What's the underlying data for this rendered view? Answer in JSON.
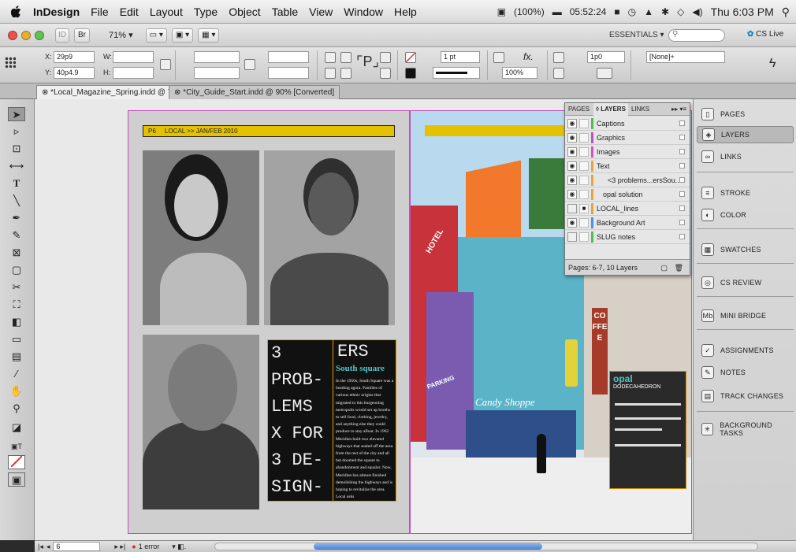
{
  "menubar": {
    "app": "InDesign",
    "items": [
      "File",
      "Edit",
      "Layout",
      "Type",
      "Object",
      "Table",
      "View",
      "Window",
      "Help"
    ],
    "battery": "(100%)",
    "timer": "05:52:24",
    "clock": "Thu 6:03 PM"
  },
  "appbar": {
    "br": "Br",
    "zoom": "71%",
    "workspace": "ESSENTIALS",
    "cslive": "CS Live"
  },
  "control": {
    "x_label": "X:",
    "x_value": "29p9",
    "y_label": "Y:",
    "y_value": "40p4.9",
    "w_label": "W:",
    "h_label": "H:",
    "stroke_weight": "1 pt",
    "opacity": "100%",
    "spacing": "1p0",
    "style": "[None]+"
  },
  "tabs": [
    {
      "label": "*Local_Magazine_Spring.indd @ 71%"
    },
    {
      "label": "*City_Guide_Start.indd @ 90% [Converted]"
    }
  ],
  "spread": {
    "folio": "P6",
    "header": "LOCAL >> JAN/FEB 2010",
    "big_title_left": [
      "3",
      "PROB-",
      "LEMS",
      "X FOR",
      "3 DE-",
      "SIGN-"
    ],
    "big_title_right": "ERS",
    "subhead": "South square",
    "body": "In the 1950s, South Square was a bustling agora. Families of various ethnic origins that migrated to this burgeoning metropolis would set up booths to sell food, clothing, jewelry, and anything else they could produce to stay afloat. In 1962 Meridien built two elevated highways that sealed off the area from the rest of the city and all but doomed the square to abandonment and squalor. Now, Meridien has almost finished demolishing the highways and is hoping to revitalize the area. Local asks",
    "opal_title": "opal",
    "opal_sub": "DODECAHEDRON",
    "sign_parking": "PARKING",
    "sign_shoppe": "Candy Shoppe",
    "sign_coffee": "COFFEE",
    "sign_hotel": "HOTEL"
  },
  "layers_panel": {
    "tabs": [
      "PAGES",
      "LAYERS",
      "LINKS"
    ],
    "rows": [
      {
        "name": "Captions",
        "color": "#4fbf4f",
        "visible": true
      },
      {
        "name": "Graphics",
        "color": "#c04fc8",
        "visible": true
      },
      {
        "name": "Images",
        "color": "#d84fc0",
        "visible": true
      },
      {
        "name": "Text",
        "color": "#e8a43a",
        "visible": true
      },
      {
        "name": "<3 problems...ersSou...>",
        "color": "#e8a43a",
        "visible": true
      },
      {
        "name": "opal solution",
        "color": "#e8a43a",
        "visible": true
      },
      {
        "name": "LOCAL_lines",
        "color": "#e8a43a",
        "visible": false
      },
      {
        "name": "Background Art",
        "color": "#4f8fe8",
        "visible": true
      },
      {
        "name": "SLUG notes",
        "color": "#4fbf4f",
        "visible": false
      }
    ],
    "footer": "Pages: 6-7, 10 Layers"
  },
  "right_panel": {
    "items": [
      "PAGES",
      "LAYERS",
      "LINKS",
      "STROKE",
      "COLOR",
      "SWATCHES",
      "CS REVIEW",
      "MINI BRIDGE",
      "ASSIGNMENTS",
      "NOTES",
      "TRACK CHANGES",
      "BACKGROUND TASKS"
    ]
  },
  "status": {
    "page": "6",
    "errors": "1 error"
  }
}
